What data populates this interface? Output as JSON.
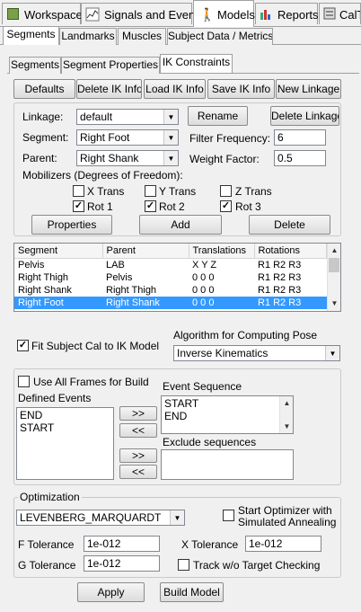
{
  "main_tabs": [
    {
      "label": "Workspace",
      "icon": "workspace-icon"
    },
    {
      "label": "Signals and Events",
      "icon": "signals-icon"
    },
    {
      "label": "Models",
      "icon": "models-icon"
    },
    {
      "label": "Reports",
      "icon": "reports-icon"
    },
    {
      "label": "CalT",
      "icon": "calc-icon"
    }
  ],
  "sub_tabs": [
    "Segments",
    "Landmarks",
    "Muscles",
    "Subject Data / Metrics"
  ],
  "inner_tabs": [
    "Segments",
    "Segment Properties",
    "IK Constraints"
  ],
  "toolbar": [
    "Defaults",
    "Delete IK Info",
    "Load IK Info",
    "Save IK Info",
    "New Linkage"
  ],
  "form": {
    "linkage_label": "Linkage:",
    "linkage_value": "default",
    "segment_label": "Segment:",
    "segment_value": "Right Foot",
    "parent_label": "Parent:",
    "parent_value": "Right Shank",
    "rename": "Rename",
    "delete_linkage": "Delete Linkage",
    "filter_label": "Filter Frequency:",
    "filter_value": "6",
    "weight_label": "Weight Factor:",
    "weight_value": "0.5",
    "mobilizers_label": "Mobilizers (Degrees of Freedom):",
    "xtrans": "X Trans",
    "ytrans": "Y Trans",
    "ztrans": "Z Trans",
    "rot1": "Rot 1",
    "rot2": "Rot 2",
    "rot3": "Rot 3",
    "properties": "Properties",
    "add": "Add",
    "delete": "Delete"
  },
  "table": {
    "headers": [
      "Segment",
      "Parent",
      "Translations",
      "Rotations"
    ],
    "rows": [
      {
        "segment": "Pelvis",
        "parent": "LAB",
        "trans": "X  Y  Z",
        "rot": "R1  R2  R3"
      },
      {
        "segment": "Right Thigh",
        "parent": "Pelvis",
        "trans": "0  0  0",
        "rot": "R1  R2  R3"
      },
      {
        "segment": "Right Shank",
        "parent": "Right Thigh",
        "trans": "0  0  0",
        "rot": "R1  R2  R3"
      },
      {
        "segment": "Right Foot",
        "parent": "Right Shank",
        "trans": "0  0  0",
        "rot": "R1  R2  R3"
      }
    ]
  },
  "fit_label": "Fit Subject Cal to IK Model",
  "algorithm_label": "Algorithm for Computing Pose",
  "algorithm_value": "Inverse Kinematics",
  "events": {
    "use_all_frames": "Use All Frames for Build",
    "defined_label": "Defined Events",
    "defined": [
      "END",
      "START"
    ],
    "sequence_label": "Event Sequence",
    "sequence": [
      "START",
      "END"
    ],
    "exclude_label": "Exclude sequences",
    "add_arrow": ">>",
    "remove_arrow": "<<"
  },
  "optimization": {
    "title": "Optimization",
    "method": "LEVENBERG_MARQUARDT",
    "annealing": "Start Optimizer with Simulated Annealing",
    "annealing_line1": "Start Optimizer with",
    "annealing_line2": "Simulated Annealing",
    "ftol_label": "F Tolerance",
    "ftol": "1e-012",
    "xtol_label": "X Tolerance",
    "xtol": "1e-012",
    "gtol_label": "G Tolerance",
    "gtol": "1e-012",
    "track": "Track w/o Target Checking"
  },
  "footer": {
    "apply": "Apply",
    "build": "Build Model"
  },
  "colors": {
    "selection": "#3399ff"
  }
}
